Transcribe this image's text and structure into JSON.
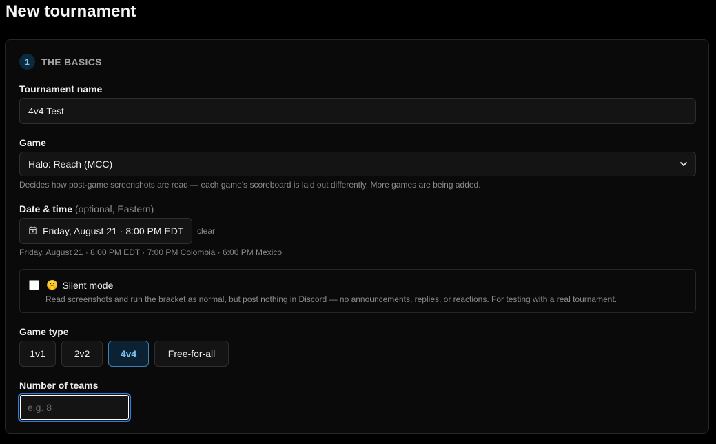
{
  "page": {
    "title": "New tournament"
  },
  "section": {
    "number": "1",
    "title": "THE BASICS"
  },
  "name_field": {
    "label": "Tournament name",
    "value": "4v4 Test"
  },
  "game_field": {
    "label": "Game",
    "value": "Halo: Reach (MCC)",
    "help": "Decides how post-game screenshots are read — each game's scoreboard is laid out differently. More games are being added."
  },
  "date_field": {
    "label": "Date & time",
    "hint": "(optional, Eastern)",
    "value": "Friday, August 21 · 8:00 PM EDT",
    "clear_label": "clear",
    "conversions": "Friday, August 21 · 8:00 PM EDT · 7:00 PM Colombia · 6:00 PM Mexico"
  },
  "silent_mode": {
    "emoji": "🤫",
    "label": "Silent mode",
    "checked": false,
    "description": "Read screenshots and run the bracket as normal, but post nothing in Discord — no announcements, replies, or reactions. For testing with a real tournament."
  },
  "game_type": {
    "label": "Game type",
    "options": [
      "1v1",
      "2v2",
      "4v4",
      "Free-for-all"
    ],
    "selected": "4v4"
  },
  "teams_field": {
    "label": "Number of teams",
    "placeholder": "e.g. 8",
    "value": ""
  },
  "colors": {
    "accent": "#7cc4f0",
    "focus": "#2f7fe0",
    "background": "#000000",
    "card": "#0a0a0a"
  },
  "icons": {
    "date": "calendar-icon",
    "select": "chevron-down-icon"
  }
}
